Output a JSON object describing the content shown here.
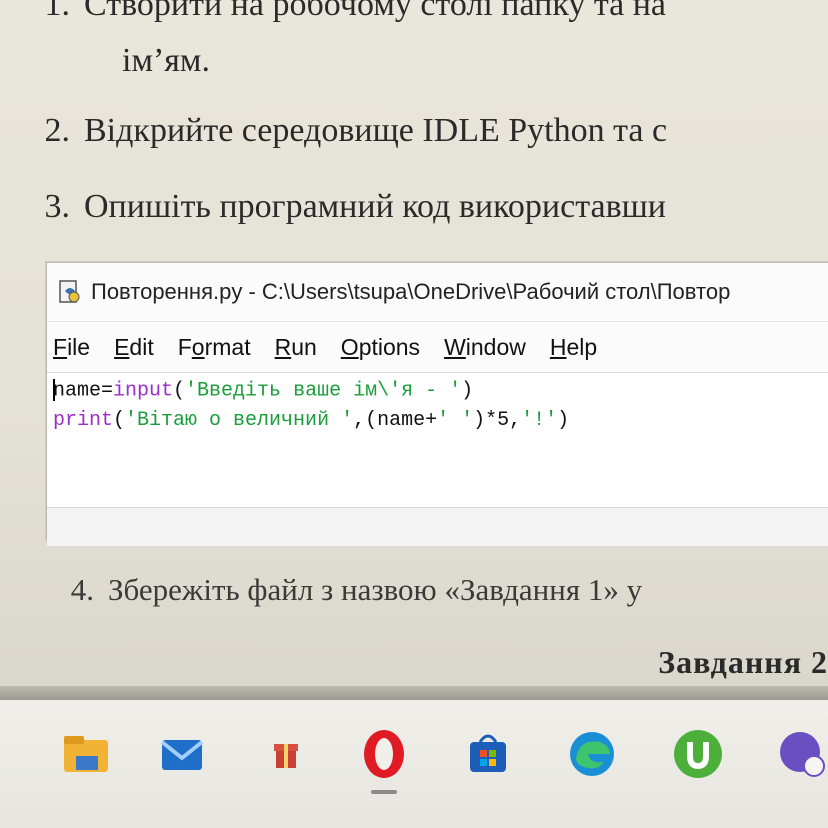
{
  "document": {
    "step1": {
      "num": "1.",
      "text": "Створити на робочому столі папку та на"
    },
    "step1_cont": "ім’ям.",
    "step2": {
      "num": "2.",
      "text": "Відкрийте середовище IDLE Python та с"
    },
    "step3": {
      "num": "3.",
      "text": "Опишіть програмний код використавши"
    },
    "step4": {
      "num": "4.",
      "text": "Збережіть файл з назвою «Завдання 1» у"
    },
    "task2_heading": "Завдання 2"
  },
  "idle_window": {
    "title": "Повторення.py - C:\\Users\\tsupa\\OneDrive\\Рабочий стол\\Повтор",
    "menu": [
      {
        "u": "F",
        "rest": "ile"
      },
      {
        "u": "E",
        "rest": "dit"
      },
      {
        "pre": "F",
        "u": "o",
        "rest": "rmat"
      },
      {
        "u": "R",
        "rest": "un"
      },
      {
        "u": "O",
        "rest": "ptions"
      },
      {
        "u": "W",
        "rest": "indow"
      },
      {
        "u": "H",
        "rest": "elp"
      }
    ],
    "code": {
      "line1": {
        "a": "name=",
        "b": "input",
        "c": "(",
        "d": "'Введіть ваше ім\\'я - '",
        "e": ")"
      },
      "line2": {
        "a": "print",
        "b": "(",
        "c": "'Вітаю о величний '",
        "d": ",(name+",
        "e": "' '",
        "f": ")*5,",
        "g": "'!'",
        "h": ")"
      }
    }
  },
  "colors": {
    "keyword": "#9a2ec7",
    "string": "#1a9e3a",
    "taskbar": "#f0efea"
  },
  "taskbar_icons": [
    "file-explorer-icon",
    "mail-icon",
    "gift-icon",
    "opera-icon",
    "store-icon",
    "edge-icon",
    "utorrent-icon",
    "chat-icon"
  ]
}
